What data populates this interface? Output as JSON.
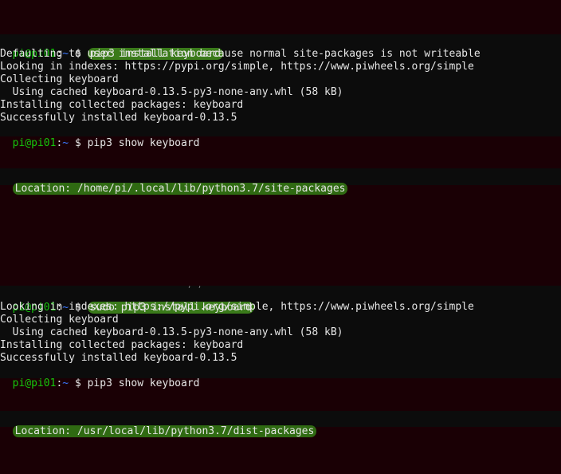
{
  "session1": {
    "prompt_user": "pi@pi01",
    "prompt_path": "~",
    "prompt_symbol": "$",
    "command1": "pip3 install keyboard",
    "output": [
      "Defaulting to user installation because normal site-packages is not writeable",
      "Looking in indexes: https://pypi.org/simple, https://www.piwheels.org/simple",
      "Collecting keyboard",
      "  Using cached keyboard-0.13.5-py3-none-any.whl (58 kB)",
      "Installing collected packages: keyboard",
      "Successfully installed keyboard-0.13.5"
    ],
    "command2": "pip3 show keyboard",
    "location": "Location: /home/pi/.local/lib/python3.7/site-packages"
  },
  "session2": {
    "prompt_user": "pi@pi01",
    "prompt_path": "~",
    "prompt_symbol": "$",
    "command1": "sudo pip3 install keyboard",
    "output": [
      "Looking in indexes: https://pypi.org/simple, https://www.piwheels.org/simple",
      "Collecting keyboard",
      "  Using cached keyboard-0.13.5-py3-none-any.whl (58 kB)",
      "Installing collected packages: keyboard",
      "Successfully installed keyboard-0.13.5"
    ],
    "command2": "pip3 show keyboard",
    "location": "Location: /usr/local/lib/python3.7/dist-packages"
  },
  "colors": {
    "background": "#1a0005",
    "terminal_bg": "#0c0c0c",
    "prompt_user": "#16c60c",
    "prompt_path": "#3b78ff",
    "highlight": "#3a7a1a"
  }
}
